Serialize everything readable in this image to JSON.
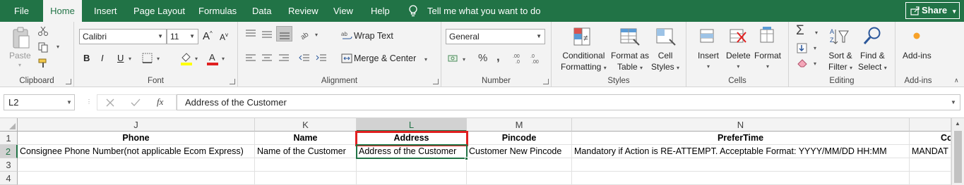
{
  "menu_tabs": [
    "File",
    "Home",
    "Insert",
    "Page Layout",
    "Formulas",
    "Data",
    "Review",
    "View",
    "Help"
  ],
  "tell_me": "Tell me what you want to do",
  "share_label": "Share",
  "ribbon": {
    "clipboard": {
      "label": "Clipboard",
      "paste": "Paste"
    },
    "font": {
      "label": "Font",
      "name": "Calibri",
      "size": "11",
      "bold": "B",
      "italic": "I",
      "underline": "U",
      "grow": "A",
      "shrink": "A"
    },
    "alignment": {
      "label": "Alignment",
      "wrap": "Wrap Text",
      "merge": "Merge & Center"
    },
    "number": {
      "label": "Number",
      "format": "General",
      "percent": "%",
      "comma": ","
    },
    "styles": {
      "label": "Styles",
      "conditional": [
        "Conditional",
        "Formatting"
      ],
      "format_table": [
        "Format as",
        "Table"
      ],
      "cell_styles": [
        "Cell",
        "Styles"
      ]
    },
    "cells": {
      "label": "Cells",
      "insert": "Insert",
      "delete": "Delete",
      "format": "Format"
    },
    "editing": {
      "label": "Editing",
      "sort": [
        "Sort &",
        "Filter"
      ],
      "find": [
        "Find &",
        "Select"
      ]
    },
    "addins": {
      "label": "Add-ins",
      "button": "Add-ins"
    }
  },
  "formula_bar": {
    "name_box": "L2",
    "fx": "fx",
    "value": "Address of the Customer"
  },
  "columns": [
    "J",
    "K",
    "L",
    "M",
    "N"
  ],
  "rows": [
    "1",
    "2",
    "3",
    "4"
  ],
  "cells": {
    "r1": [
      "Phone",
      "Name",
      "Address",
      "Pincode",
      "PreferTime",
      "Co"
    ],
    "r2": [
      "Consignee Phone Number(not applicable Ecom Express)",
      "Name of the Customer",
      "Address of the Customer",
      "Customer New Pincode",
      "Mandatory if Action is RE-ATTEMPT. Acceptable Format: YYYY/MM/DD HH:MM",
      "MANDAT"
    ]
  },
  "colors": {
    "accent": "#217346",
    "highlight_box": "#e02020"
  }
}
